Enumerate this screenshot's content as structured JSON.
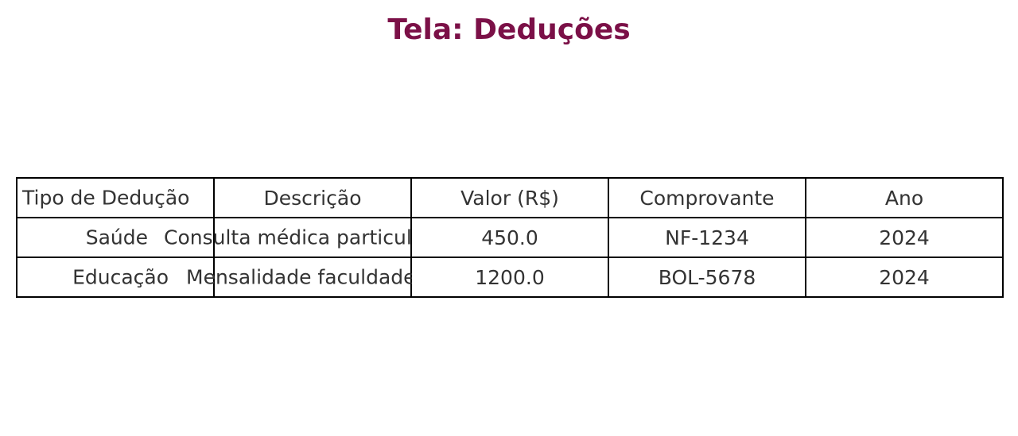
{
  "page": {
    "title": "Tela: Deduções",
    "title_color": "#7b1047"
  },
  "chart_data": {
    "type": "table",
    "columns": [
      "Tipo de Dedução",
      "Descrição",
      "Valor (R$)",
      "Comprovante",
      "Ano"
    ],
    "rows": [
      [
        "Saúde",
        "Consulta médica particular",
        "450.0",
        "NF-1234",
        "2024"
      ],
      [
        "Educação",
        "Mensalidade faculdade",
        "1200.0",
        "BOL-5678",
        "2024"
      ]
    ],
    "grid": true
  }
}
